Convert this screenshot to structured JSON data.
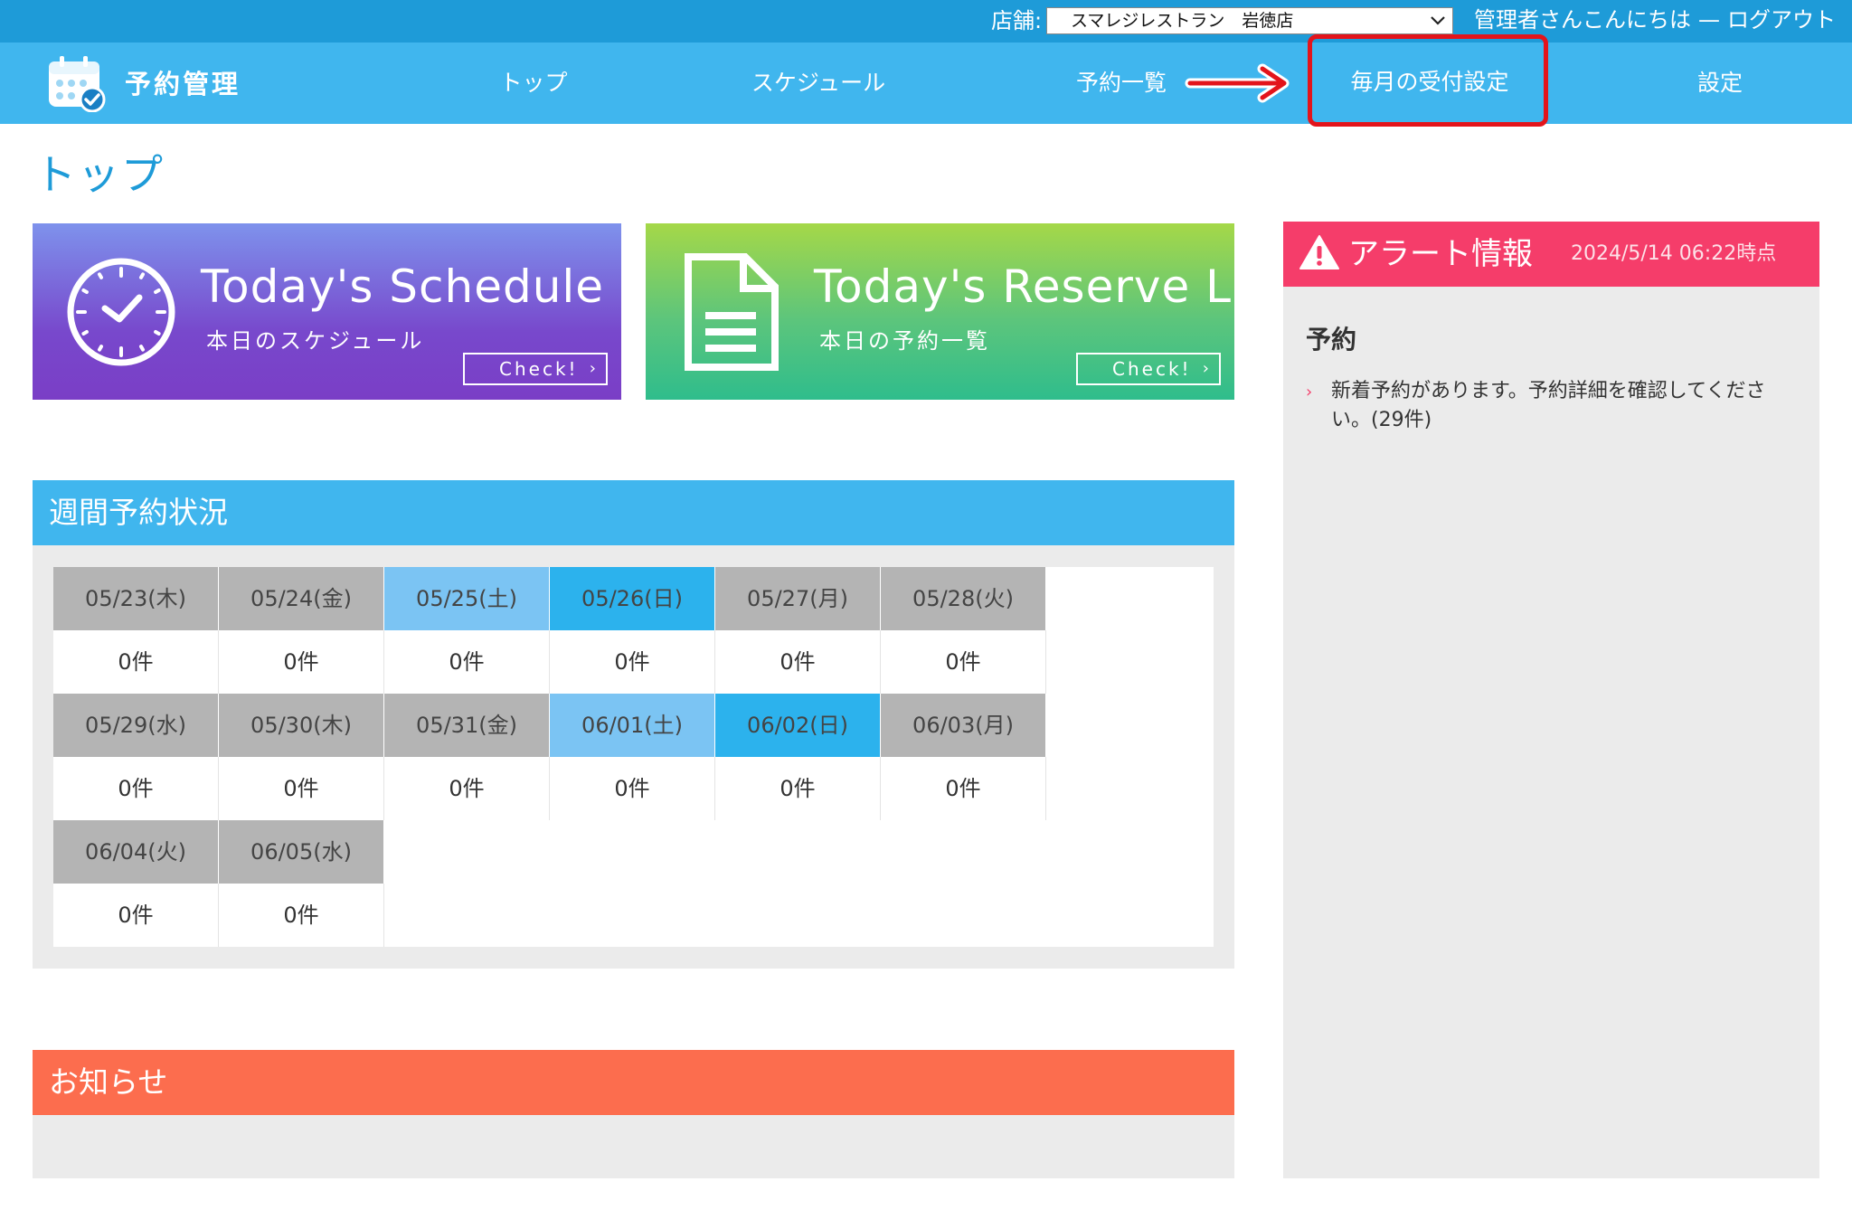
{
  "topbar": {
    "store_label": "店舗:",
    "store_selected": "スマレジレストラン　岩徳店",
    "greeting": "管理者さんこんにちは",
    "separator": "—",
    "logout": "ログアウト"
  },
  "nav": {
    "logo_text": "予約管理",
    "items": [
      "トップ",
      "スケジュール",
      "予約一覧",
      "毎月の受付設定",
      "設定"
    ]
  },
  "page": {
    "title": "トップ"
  },
  "cards": {
    "schedule": {
      "title": "Today's Schedule",
      "subtitle": "本日のスケジュール",
      "check": "Check!"
    },
    "reserve": {
      "title": "Today's Reserve List",
      "subtitle": "本日の予約一覧",
      "check": "Check!"
    }
  },
  "weekly": {
    "title": "週間予約状況",
    "days": [
      {
        "date": "05/23(木)",
        "count": "0件",
        "type": "weekday"
      },
      {
        "date": "05/24(金)",
        "count": "0件",
        "type": "weekday"
      },
      {
        "date": "05/25(土)",
        "count": "0件",
        "type": "saturday"
      },
      {
        "date": "05/26(日)",
        "count": "0件",
        "type": "sunday"
      },
      {
        "date": "05/27(月)",
        "count": "0件",
        "type": "weekday"
      },
      {
        "date": "05/28(火)",
        "count": "0件",
        "type": "weekday"
      },
      {
        "date": "05/29(水)",
        "count": "0件",
        "type": "weekday"
      },
      {
        "date": "05/30(木)",
        "count": "0件",
        "type": "weekday"
      },
      {
        "date": "05/31(金)",
        "count": "0件",
        "type": "weekday"
      },
      {
        "date": "06/01(土)",
        "count": "0件",
        "type": "saturday"
      },
      {
        "date": "06/02(日)",
        "count": "0件",
        "type": "sunday"
      },
      {
        "date": "06/03(月)",
        "count": "0件",
        "type": "weekday"
      },
      {
        "date": "06/04(火)",
        "count": "0件",
        "type": "weekday"
      },
      {
        "date": "06/05(水)",
        "count": "0件",
        "type": "weekday"
      }
    ]
  },
  "news": {
    "title": "お知らせ"
  },
  "alert": {
    "title": "アラート情報",
    "timestamp": "2024/5/14 06:22時点",
    "section": "予約",
    "bullet": "›",
    "message": "新着予約があります。予約詳細を確認してください。(29件)"
  },
  "colors": {
    "topbar": "#1e9bd8",
    "nav": "#40b6ee",
    "highlight": "#e3141b",
    "alert_header": "#f53d6a",
    "news_header": "#fc6d4e",
    "saturday": "#7bc4f3",
    "sunday": "#2cb2ed",
    "weekday": "#b4b4b4"
  },
  "icons": [
    "calendar-check-icon",
    "clock-icon",
    "document-icon",
    "warning-icon",
    "chevron-down-icon",
    "arrow-right-icon"
  ]
}
